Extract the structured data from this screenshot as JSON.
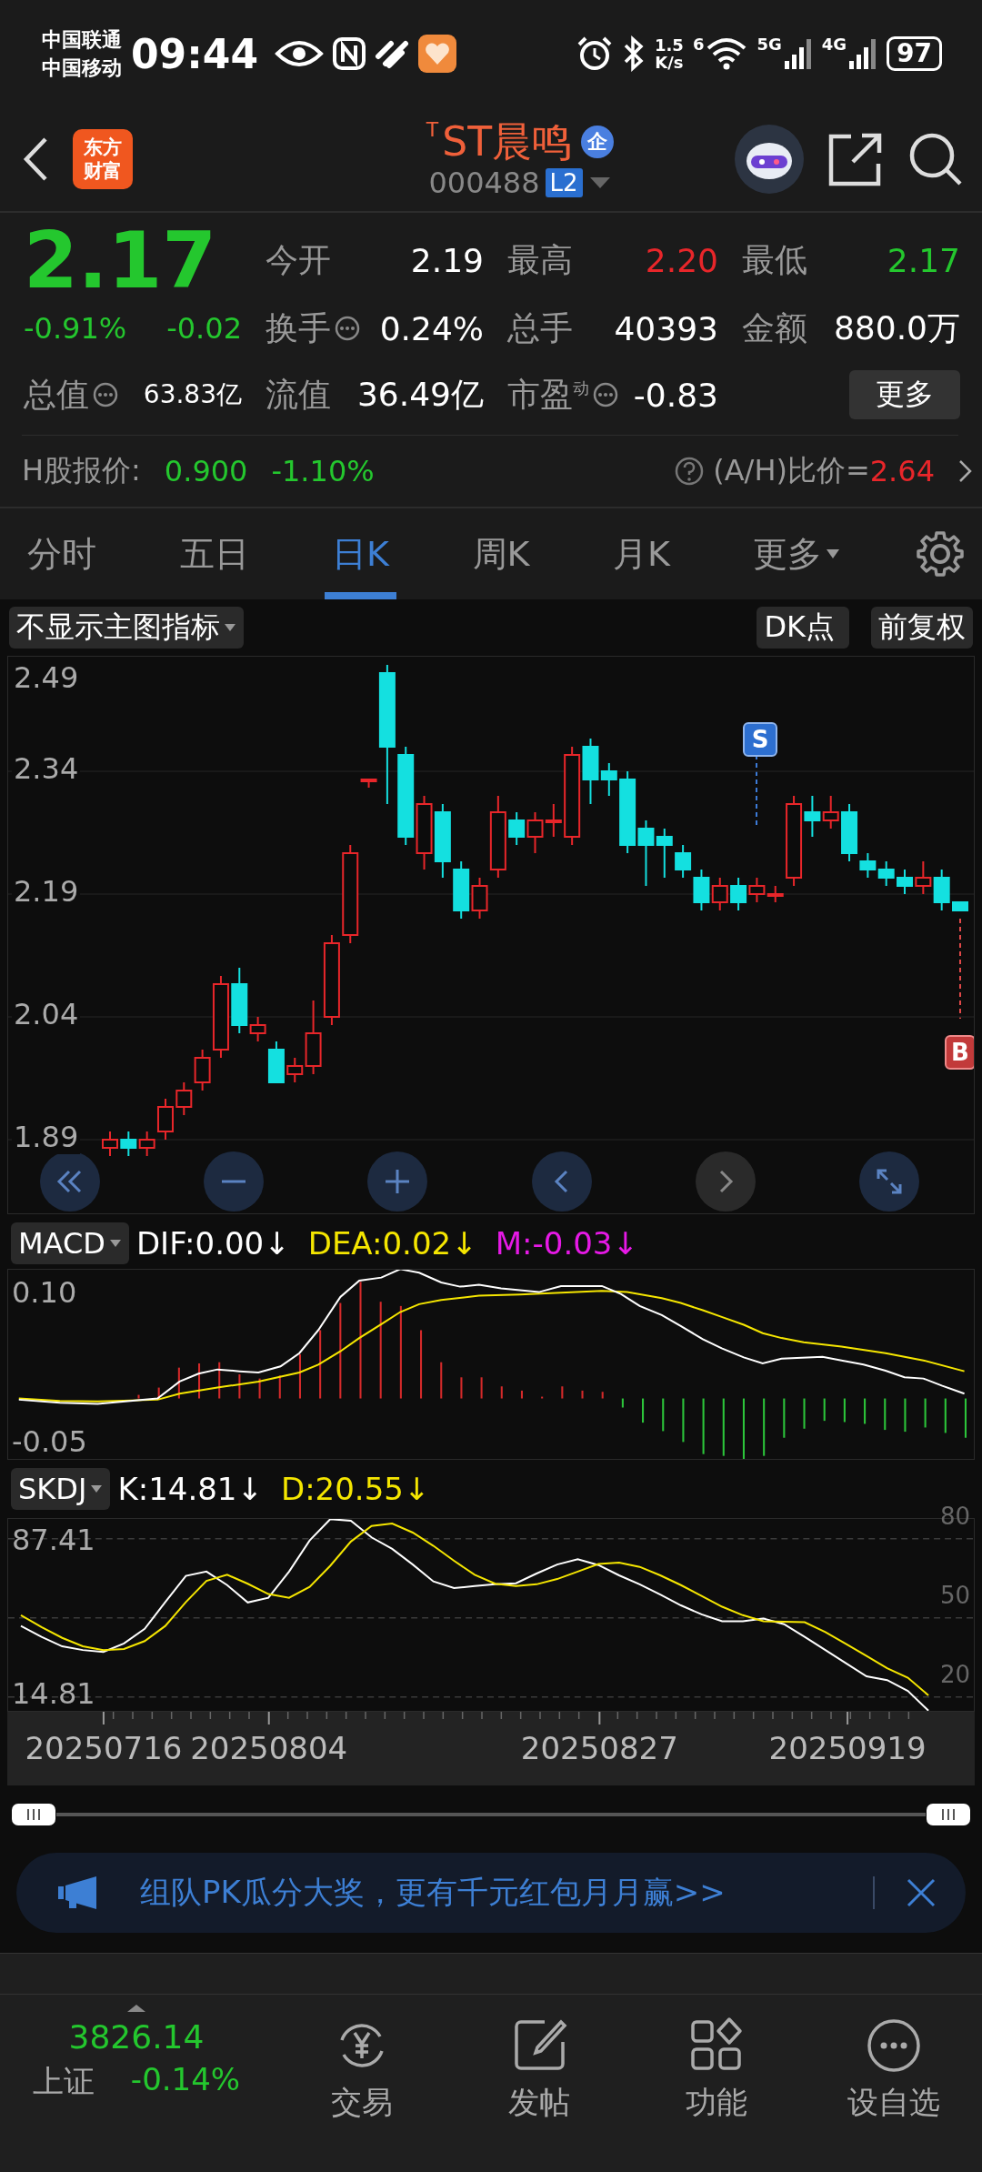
{
  "status_bar": {
    "carriers": [
      "中国联通",
      "中国移动"
    ],
    "time": "09:44",
    "speed": [
      "1.5",
      "K/s"
    ],
    "wifi_badge": "6",
    "networks": [
      "5G",
      "4G"
    ],
    "battery": "97"
  },
  "header": {
    "logo": [
      "东方",
      "财富"
    ],
    "title_mark": "T",
    "title": "ST晨鸣",
    "badge": "企",
    "code": "000488",
    "level": "L2"
  },
  "quote": {
    "price": "2.17",
    "change_pct": "-0.91%",
    "change": "-0.02",
    "color": "#24c72e",
    "stats": [
      {
        "label": "今开",
        "value": "2.19",
        "color": "#ffffff",
        "info": false
      },
      {
        "label": "最高",
        "value": "2.20",
        "color": "#e8262a",
        "info": false
      },
      {
        "label": "最低",
        "value": "2.17",
        "color": "#24c72e",
        "info": false
      },
      {
        "label": "换手",
        "value": "0.24%",
        "color": "#ffffff",
        "info": true
      },
      {
        "label": "总手",
        "value": "40393",
        "color": "#ffffff",
        "info": false
      },
      {
        "label": "金额",
        "value": "880.0万",
        "color": "#ffffff",
        "info": false
      },
      {
        "label": "总值",
        "value": "63.83亿",
        "color": "#ffffff",
        "info": true
      },
      {
        "label": "流值",
        "value": "36.49亿",
        "color": "#ffffff",
        "info": false
      },
      {
        "label": "市盈$^{动}$",
        "value": "-0.83",
        "color": "#ffffff",
        "info": true
      }
    ],
    "more_button": "更多"
  },
  "h_share": {
    "label": "H股报价:",
    "price": "0.900",
    "change": "-1.10%",
    "ratio_label": "(A/H)比价=",
    "ratio": "2.64"
  },
  "tabs": [
    {
      "label": "分时",
      "selected": false,
      "dropdown": false
    },
    {
      "label": "五日",
      "selected": false,
      "dropdown": false
    },
    {
      "label": "日K",
      "selected": true,
      "dropdown": false
    },
    {
      "label": "周K",
      "selected": false,
      "dropdown": false
    },
    {
      "label": "月K",
      "selected": false,
      "dropdown": false
    },
    {
      "label": "更多",
      "selected": false,
      "dropdown": true
    }
  ],
  "chart_toolbar": {
    "indicator": "不显示主图指标",
    "dk": "DK点",
    "adjust": "前复权"
  },
  "main_chart": {
    "sell_marker": "S",
    "buy_marker": "B",
    "top_label": "2.49",
    "chart_data": {
      "type": "candlestick",
      "categories": [
        null,
        null,
        null,
        null,
        null,
        null,
        null,
        null,
        null,
        null,
        null,
        null,
        null,
        null,
        null,
        null,
        null,
        null,
        null,
        null,
        null,
        null,
        null,
        null,
        null,
        null,
        null,
        null,
        null,
        null,
        null,
        null,
        null,
        null,
        null,
        null,
        null,
        null,
        null,
        null,
        null,
        null,
        null,
        null,
        null,
        null,
        null
      ],
      "ylim": [
        1.8,
        2.48
      ],
      "yticks": [
        2.34,
        2.19,
        2.04,
        1.89
      ],
      "grid": true,
      "ohlc": [
        [
          1.88,
          1.9,
          1.87,
          1.89
        ],
        [
          1.89,
          1.9,
          1.87,
          1.88
        ],
        [
          1.88,
          1.9,
          1.87,
          1.89
        ],
        [
          1.9,
          1.94,
          1.89,
          1.93
        ],
        [
          1.93,
          1.96,
          1.92,
          1.95
        ],
        [
          1.96,
          2.0,
          1.95,
          1.99
        ],
        [
          2.0,
          2.09,
          1.99,
          2.08
        ],
        [
          2.08,
          2.1,
          2.02,
          2.03
        ],
        [
          2.02,
          2.04,
          2.01,
          2.03
        ],
        [
          2.0,
          2.01,
          1.96,
          1.96
        ],
        [
          1.97,
          1.99,
          1.96,
          1.98
        ],
        [
          1.98,
          2.06,
          1.97,
          2.02
        ],
        [
          2.04,
          2.14,
          2.03,
          2.13
        ],
        [
          2.14,
          2.25,
          2.13,
          2.24
        ],
        [
          2.33,
          2.33,
          2.32,
          2.33
        ],
        [
          2.46,
          2.47,
          2.3,
          2.37
        ],
        [
          2.36,
          2.37,
          2.25,
          2.26
        ],
        [
          2.24,
          2.31,
          2.22,
          2.3
        ],
        [
          2.29,
          2.3,
          2.21,
          2.23
        ],
        [
          2.22,
          2.23,
          2.16,
          2.17
        ],
        [
          2.17,
          2.21,
          2.16,
          2.2
        ],
        [
          2.22,
          2.31,
          2.21,
          2.29
        ],
        [
          2.28,
          2.29,
          2.25,
          2.26
        ],
        [
          2.26,
          2.29,
          2.24,
          2.28
        ],
        [
          2.28,
          2.3,
          2.26,
          2.28
        ],
        [
          2.26,
          2.37,
          2.25,
          2.36
        ],
        [
          2.37,
          2.38,
          2.3,
          2.33
        ],
        [
          2.34,
          2.35,
          2.31,
          2.33
        ],
        [
          2.33,
          2.34,
          2.24,
          2.25
        ],
        [
          2.27,
          2.28,
          2.2,
          2.25
        ],
        [
          2.26,
          2.27,
          2.21,
          2.25
        ],
        [
          2.24,
          2.25,
          2.21,
          2.22
        ],
        [
          2.21,
          2.22,
          2.17,
          2.18
        ],
        [
          2.18,
          2.21,
          2.17,
          2.2
        ],
        [
          2.2,
          2.21,
          2.17,
          2.18
        ],
        [
          2.19,
          2.21,
          2.18,
          2.2
        ],
        [
          2.19,
          2.2,
          2.18,
          2.19
        ],
        [
          2.21,
          2.31,
          2.2,
          2.3
        ],
        [
          2.29,
          2.31,
          2.26,
          2.28
        ],
        [
          2.28,
          2.31,
          2.27,
          2.29
        ],
        [
          2.29,
          2.3,
          2.23,
          2.24
        ],
        [
          2.23,
          2.24,
          2.21,
          2.22
        ],
        [
          2.22,
          2.23,
          2.2,
          2.21
        ],
        [
          2.21,
          2.22,
          2.19,
          2.2
        ],
        [
          2.2,
          2.23,
          2.19,
          2.21
        ],
        [
          2.21,
          2.22,
          2.17,
          2.18
        ],
        [
          2.18,
          2.18,
          2.17,
          2.17
        ]
      ]
    }
  },
  "macd": {
    "name": "MACD",
    "readouts": [
      {
        "text": "DIF:0.00↓",
        "color": "#ffffff"
      },
      {
        "text": "DEA:0.02↓",
        "color": "#f5e600"
      },
      {
        "text": "M:-0.03↓",
        "color": "#e619e6"
      }
    ],
    "y_labels": [
      "0.10",
      "-0.05"
    ]
  },
  "skdj": {
    "name": "SKDJ",
    "readouts": [
      {
        "text": "K:14.81↓",
        "color": "#ffffff"
      },
      {
        "text": "D:20.55↓",
        "color": "#f5e600"
      }
    ],
    "y_labels": [
      "87.41",
      "14.81"
    ],
    "chart_data": {
      "type": "line",
      "categories": [
        null,
        null,
        null,
        null,
        "20250716",
        null,
        null,
        null,
        null,
        null,
        null,
        null,
        "20250804",
        null,
        null,
        null,
        null,
        null,
        null,
        null,
        null,
        null,
        null,
        null,
        null,
        null,
        null,
        null,
        "20250827",
        null,
        null,
        null,
        null,
        null,
        null,
        null,
        null,
        null,
        null,
        null,
        "20250919",
        null,
        null,
        null,
        null
      ],
      "ylim": [
        14.8,
        87.4
      ],
      "yticks": [
        20,
        50,
        80
      ],
      "grid": true,
      "series": [
        {
          "color": "#ffffff",
          "values": [
            46.9,
            42.8,
            39.2,
            37.8,
            37.1,
            40.3,
            45.8,
            56.0,
            65.9,
            67.5,
            62.4,
            55.8,
            57.6,
            67.5,
            79.3,
            87.4,
            86.8,
            80.5,
            76.1,
            70.2,
            63.8,
            61.3,
            62.0,
            62.7,
            63.1,
            66.8,
            70.2,
            72.2,
            70.0,
            66.1,
            62.7,
            58.8,
            54.7,
            51.3,
            48.7,
            48.7,
            49.7,
            47.6,
            42.8,
            37.8,
            32.8,
            27.8,
            26.4,
            22.3,
            14.8
          ]
        },
        {
          "color": "#f5e600",
          "values": [
            51.0,
            46.5,
            42.4,
            39.2,
            37.8,
            38.2,
            41.2,
            46.9,
            56.0,
            64.0,
            66.3,
            62.9,
            59.0,
            57.6,
            61.7,
            69.7,
            78.9,
            84.8,
            85.7,
            82.3,
            77.3,
            71.6,
            66.3,
            62.9,
            62.0,
            62.7,
            64.7,
            67.5,
            70.4,
            70.9,
            69.3,
            66.1,
            62.4,
            58.3,
            54.2,
            51.0,
            48.7,
            48.5,
            48.3,
            44.6,
            40.1,
            35.5,
            30.9,
            27.3,
            20.6
          ]
        }
      ]
    }
  },
  "banner": {
    "text": "组队PK瓜分大奖，更有千元红包月月赢>>"
  },
  "bottom_nav": {
    "index_value": "3826.14",
    "index_name": "上证",
    "index_change": "-0.14%",
    "items": [
      {
        "label": "交易",
        "kind": "trade"
      },
      {
        "label": "发帖",
        "kind": "post"
      },
      {
        "label": "功能",
        "kind": "apps"
      },
      {
        "label": "设自选",
        "kind": "more"
      }
    ]
  }
}
